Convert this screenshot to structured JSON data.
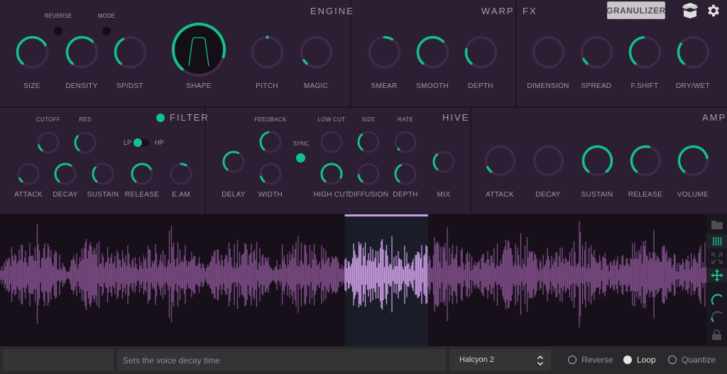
{
  "colors": {
    "accent": "#13c08e",
    "track": "#40294a",
    "panel_bg": "#2c1f33",
    "waveform": "#7c4d86",
    "waveform_selected": "#c79be0",
    "selection_bg": "#1a1c28"
  },
  "header": {
    "mode_button": "GRANULIZER",
    "icons": [
      "package-icon",
      "gear-icon"
    ]
  },
  "engine": {
    "title": "ENGINE",
    "toggles": [
      {
        "label": "REVERSE",
        "on": false
      },
      {
        "label": "MODE",
        "on": false
      }
    ],
    "knobs": [
      {
        "label": "SIZE",
        "value": 0.72
      },
      {
        "label": "DENSITY",
        "value": 0.66
      },
      {
        "label": "SP/DST",
        "value": 0.4
      },
      {
        "label": "SHAPE",
        "value": 0.88
      },
      {
        "label": "PITCH",
        "value": 0.5
      },
      {
        "label": "MAGIC",
        "value": 0.06
      }
    ]
  },
  "warp": {
    "title": "WARP",
    "knobs": [
      {
        "label": "SMEAR",
        "value": 0.22,
        "bipolar": true
      },
      {
        "label": "SMOOTH",
        "value": 0.66
      },
      {
        "label": "DEPTH",
        "value": 0.22
      }
    ]
  },
  "fx": {
    "title": "FX",
    "knobs": [
      {
        "label": "DIMENSION",
        "value": 0.0
      },
      {
        "label": "SPREAD",
        "value": 0.08
      },
      {
        "label": "F.SHIFT",
        "value": 0.48
      },
      {
        "label": "DRY/WET",
        "value": 0.3
      }
    ]
  },
  "filter": {
    "title": "FILTER",
    "enabled": true,
    "switch": {
      "left": "LP",
      "right": "HP",
      "value": "LP"
    },
    "top_knobs": [
      {
        "label": "CUTOFF",
        "value": 0.12
      },
      {
        "label": "RES",
        "value": 0.32
      }
    ],
    "knobs": [
      {
        "label": "ATTACK",
        "value": 0.08
      },
      {
        "label": "DECAY",
        "value": 0.62
      },
      {
        "label": "SUSTAIN",
        "value": 0.32
      },
      {
        "label": "RELEASE",
        "value": 0.72
      },
      {
        "label": "E.AM",
        "value": 0.22,
        "bipolar": true
      }
    ]
  },
  "hive": {
    "title": "HIVE",
    "sync_label": "SYNC",
    "sync_on": true,
    "knobs": [
      {
        "label": "DELAY",
        "value": 0.6,
        "label_pos": "bottom"
      },
      {
        "label": "FEEDBACK",
        "value": 0.45,
        "label_pos": "top"
      },
      {
        "label": "WIDTH",
        "value": 0.12,
        "label_pos": "bottom"
      },
      {
        "label": "LOW CUT",
        "value": 0.0,
        "label_pos": "top"
      },
      {
        "label": "HIGH CUT",
        "value": 0.9,
        "label_pos": "bottom"
      },
      {
        "label": "SIZE",
        "value": 0.35,
        "label_pos": "top"
      },
      {
        "label": "DIFFUSION",
        "value": 0.15,
        "label_pos": "bottom"
      },
      {
        "label": "RATE",
        "value": 0.02,
        "label_pos": "top"
      },
      {
        "label": "DEPTH",
        "value": 0.4,
        "label_pos": "bottom"
      },
      {
        "label": "MIX",
        "value": 0.35,
        "label_pos": "bottom"
      }
    ]
  },
  "amp": {
    "title": "AMP",
    "knobs": [
      {
        "label": "ATTACK",
        "value": 0.08
      },
      {
        "label": "DECAY",
        "value": 0.0
      },
      {
        "label": "SUSTAIN",
        "value": 1.0
      },
      {
        "label": "RELEASE",
        "value": 0.55
      },
      {
        "label": "VOLUME",
        "value": 0.78
      }
    ]
  },
  "waveform": {
    "selection_start": 0.488,
    "selection_end": 0.606
  },
  "sidebar_icons": [
    "folder-icon",
    "grid-lines-icon",
    "expand-icon",
    "move-icon",
    "lfo1-knob-icon",
    "lfo2-knob-icon",
    "lock-icon"
  ],
  "footer": {
    "info_text": "Sets the voice decay time",
    "preset": "Halcyon 2",
    "options": [
      {
        "label": "Reverse",
        "checked": false
      },
      {
        "label": "Loop",
        "checked": true
      },
      {
        "label": "Quantize",
        "checked": false
      }
    ]
  }
}
